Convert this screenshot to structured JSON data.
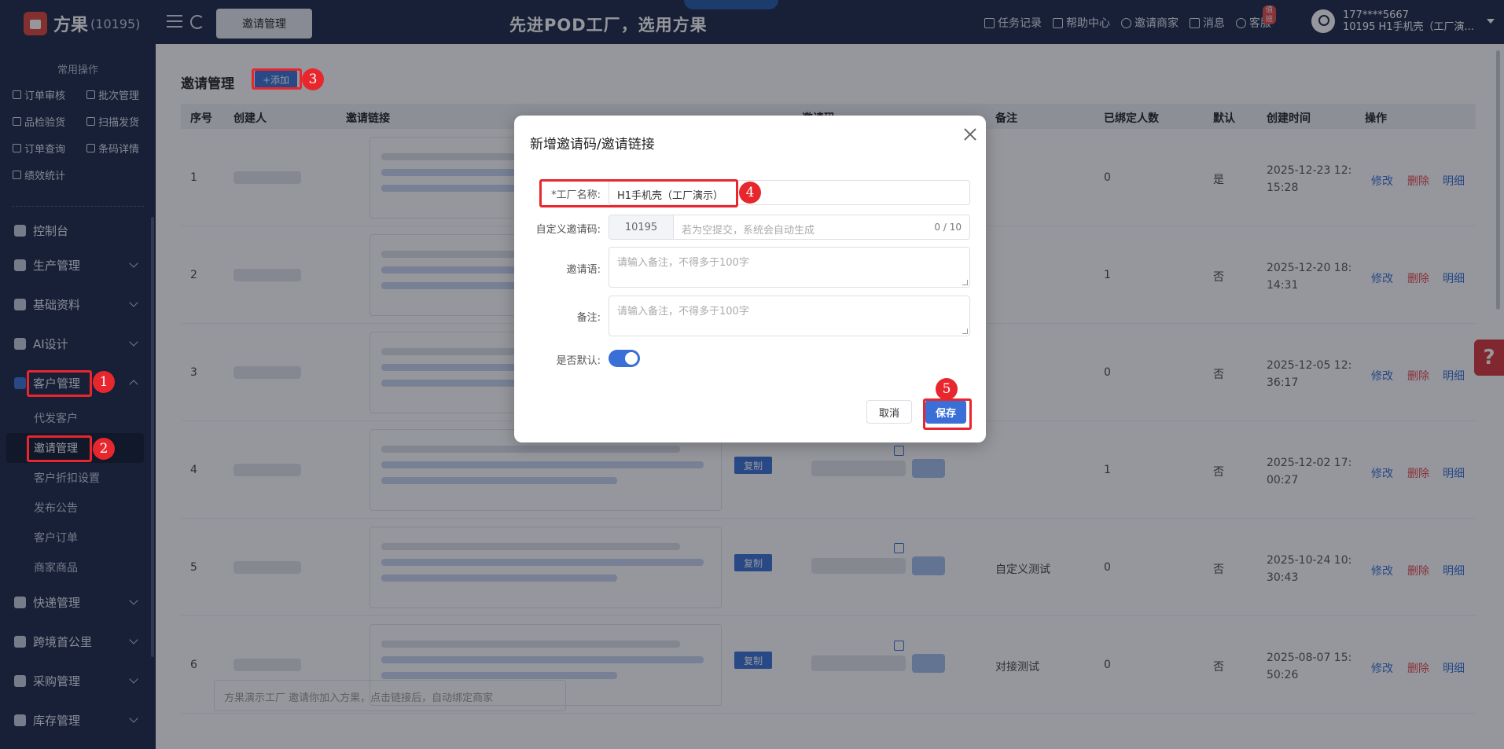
{
  "app": {
    "brand": "方果",
    "brand_id": "(10195)",
    "current_tab": "邀请管理",
    "slogan": "先进POD工厂，选用方果"
  },
  "top_links": [
    {
      "label": "任务记录",
      "icon": "task-icon"
    },
    {
      "label": "帮助中心",
      "icon": "help-icon"
    },
    {
      "label": "邀请商家",
      "icon": "invite-icon"
    },
    {
      "label": "消息",
      "icon": "message-icon"
    },
    {
      "label": "客服",
      "icon": "headset-icon",
      "badge": "值班"
    }
  ],
  "user": {
    "phone": "177****5667",
    "org": "10195  H1手机壳（工厂演..."
  },
  "sidebar": {
    "common_title": "常用操作",
    "quick_ops": [
      "订单审核",
      "批次管理",
      "品检验货",
      "扫描发货",
      "订单查询",
      "条码详情",
      "绩效统计"
    ],
    "menus": [
      "控制台",
      "生产管理",
      "基础资料",
      "AI设计",
      "客户管理",
      "快递管理",
      "跨境首公里",
      "采购管理",
      "库存管理"
    ],
    "sub_items": [
      "代发客户",
      "邀请管理",
      "客户折扣设置",
      "发布公告",
      "客户订单",
      "商家商品"
    ]
  },
  "page": {
    "title": "邀请管理",
    "add_label": "+添加"
  },
  "table": {
    "headers": [
      "序号",
      "创建人",
      "邀请链接",
      "邀请码",
      "备注",
      "已绑定人数",
      "默认",
      "创建时间",
      "操作"
    ],
    "copy_label": "复制",
    "actions": [
      "修改",
      "删除",
      "明细"
    ],
    "rows": [
      {
        "no": "1",
        "note": "",
        "bound": "0",
        "default": "是",
        "date1": "2025-12-23 12:",
        "date2": "15:28"
      },
      {
        "no": "2",
        "note": "",
        "bound": "1",
        "default": "否",
        "date1": "2025-12-20 18:",
        "date2": "14:31"
      },
      {
        "no": "3",
        "note": "",
        "bound": "0",
        "default": "否",
        "date1": "2025-12-05 12:",
        "date2": "36:17"
      },
      {
        "no": "4",
        "note": "",
        "bound": "1",
        "default": "否",
        "date1": "2025-12-02 17:",
        "date2": "00:27"
      },
      {
        "no": "5",
        "note": "自定义测试",
        "bound": "0",
        "default": "否",
        "date1": "2025-10-24 10:",
        "date2": "30:43"
      },
      {
        "no": "6",
        "note": "对接测试",
        "bound": "0",
        "default": "否",
        "date1": "2025-08-07 15:",
        "date2": "50:26"
      }
    ],
    "bottom_link_text": "方果演示工厂 邀请你加入方果，点击链接后，自动绑定商家"
  },
  "modal": {
    "title": "新增邀请码/邀请链接",
    "factory_label": "*工厂名称:",
    "factory_value": "H1手机壳（工厂演示）",
    "code_label": "自定义邀请码:",
    "code_prefix": "10195",
    "code_placeholder": "若为空提交，系统会自动生成",
    "code_counter": "0 / 10",
    "greeting_label": "邀请语:",
    "greeting_placeholder": "请输入备注，不得多于100字",
    "remark_label": "备注:",
    "remark_placeholder": "请输入备注，不得多于100字",
    "default_label": "是否默认:",
    "default_on": true,
    "cancel": "取消",
    "save": "保存"
  },
  "annotations": [
    "1",
    "2",
    "3",
    "4",
    "5"
  ],
  "colors": {
    "sidebar": "#1b2747",
    "primary": "#3a6fd8",
    "highlight": "#e8262d",
    "danger": "#e8464f"
  }
}
